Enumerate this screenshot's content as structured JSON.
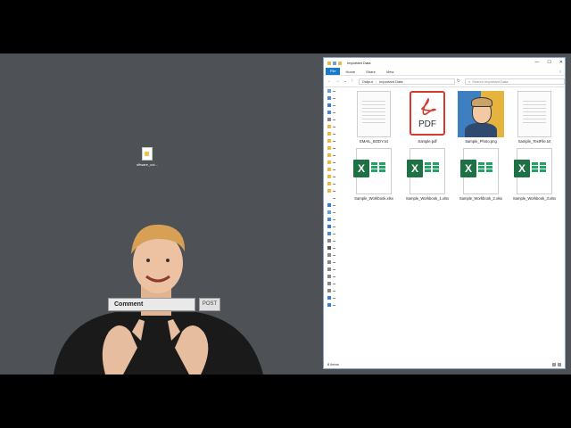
{
  "desktop": {
    "icon_label": "sftware_cut..."
  },
  "overlay": {
    "comment_label": "Comment",
    "post_label": "POST"
  },
  "window": {
    "title": "Important Data",
    "controls": {
      "minimize": "—",
      "maximize": "☐",
      "close": "✕"
    },
    "ribbon_tabs": [
      "File",
      "Home",
      "Share",
      "View"
    ],
    "help": "?",
    "breadcrumb": [
      "Output",
      "Important Data"
    ],
    "search_placeholder": "Search Important Data",
    "files": [
      {
        "name": "EMAIL_BODY.txt",
        "type": "txt"
      },
      {
        "name": "Sample.pdf",
        "type": "pdf"
      },
      {
        "name": "Sample_Photo.png",
        "type": "png"
      },
      {
        "name": "Sample_TextFile.txt",
        "type": "txt"
      },
      {
        "name": "Sample_Workbook.xlsx",
        "type": "xlsx"
      },
      {
        "name": "Sample_Workbook_1.xlsx",
        "type": "xlsx"
      },
      {
        "name": "Sample_Workbook_2.xlsx",
        "type": "xlsx"
      },
      {
        "name": "Sample_Workbook_3.xlsx",
        "type": "xlsx"
      }
    ],
    "pdf_badge": "PDF",
    "xlsx_badge": "X",
    "status": "8 items"
  },
  "colors": {
    "desktop_bg": "#4e5155",
    "accent": "#1979ca",
    "excel_green": "#1e7145",
    "pdf_red": "#d63a2e"
  }
}
